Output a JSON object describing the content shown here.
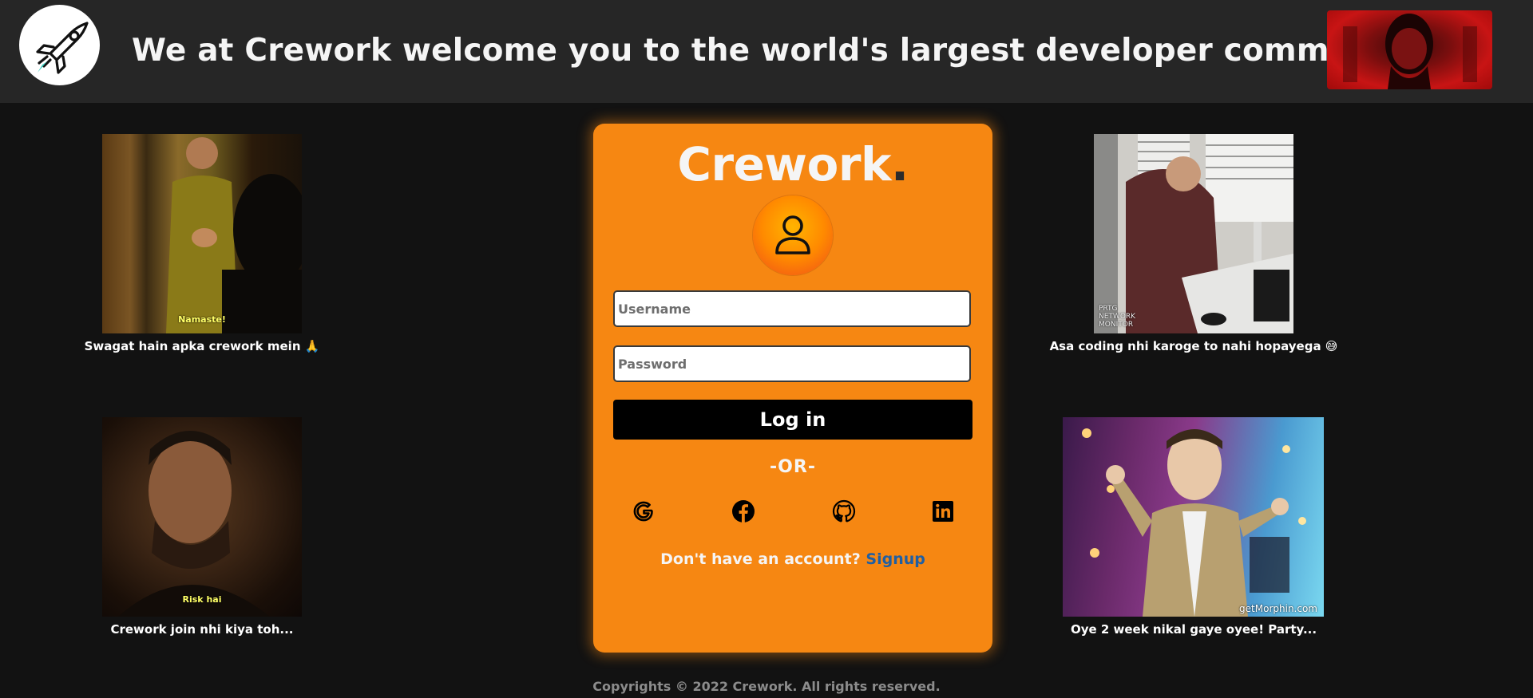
{
  "header": {
    "title": "We at Crework welcome you to the world's largest developer community.",
    "logo_icon": "rocket-icon",
    "avatar_image": "red-portrait-thumbnail"
  },
  "gifs": [
    {
      "subtitle": "Namaste!",
      "caption": "Swagat hain apka crework mein 🙏"
    },
    {
      "watermark": "PRTG NETWORK MONITOR",
      "caption": "Asa coding nhi karoge to nahi hopayega 😅"
    },
    {
      "subtitle": "Risk hai",
      "caption": "Crework join nhi kiya toh..."
    },
    {
      "watermark": "getMorphin.com",
      "caption": "Oye 2 week nikal gaye oyee! Party..."
    }
  ],
  "login": {
    "brand": "Crework",
    "brand_dot": ".",
    "user_icon": "user-icon",
    "username_placeholder": "Username",
    "password_placeholder": "Password",
    "login_label": "Log in",
    "or_label": "-OR-",
    "social": [
      "google-icon",
      "facebook-icon",
      "github-icon",
      "linkedin-icon"
    ],
    "signup_prompt": "Don't have an account?",
    "signup_label": "Signup"
  },
  "footer": {
    "copyright": "Copyrights © 2022 Crework. All rights reserved."
  },
  "colors": {
    "card": "#f68712",
    "background": "#121212",
    "header": "#262626",
    "button": "#000000",
    "link": "#1f5fa3"
  }
}
